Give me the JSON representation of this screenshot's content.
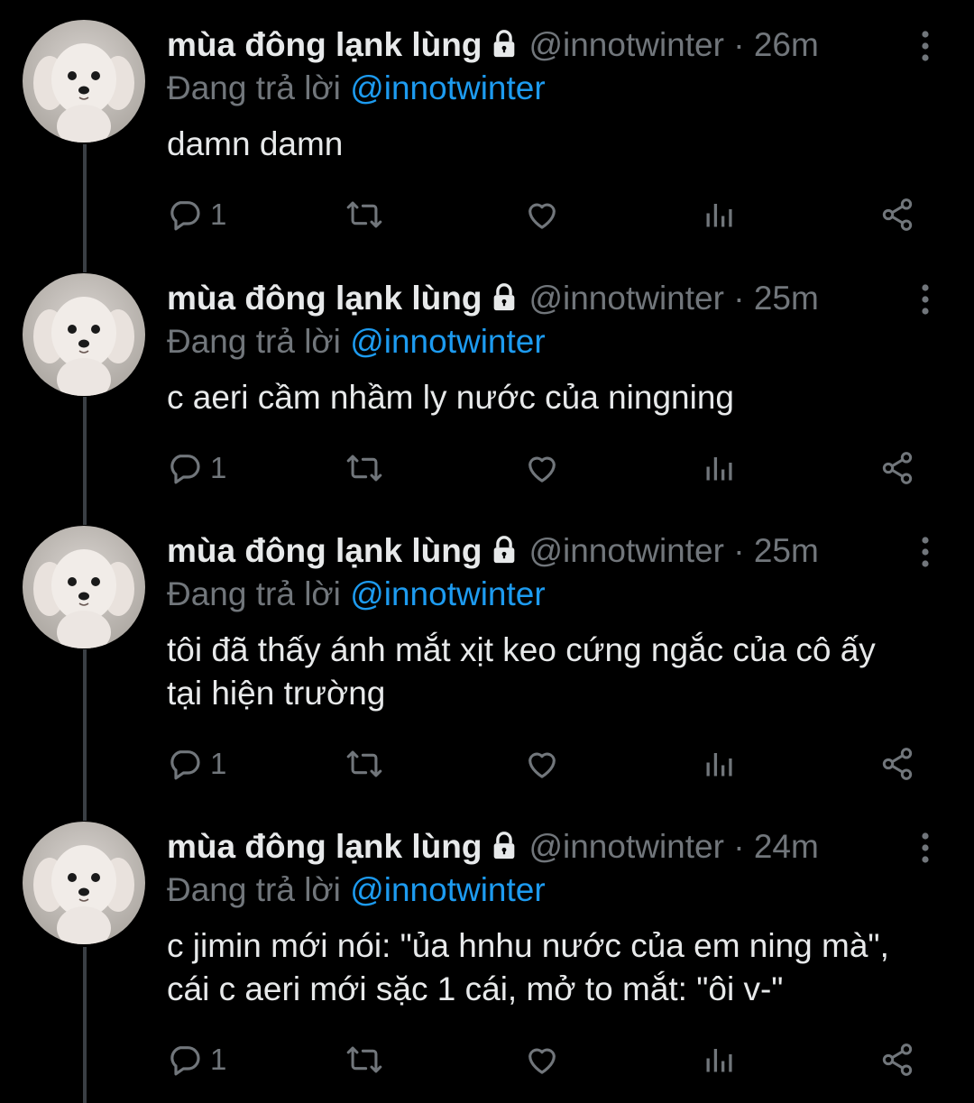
{
  "tweets": [
    {
      "name": "mùa đông lạnk lùng",
      "handle": "@innotwinter",
      "separator": "·",
      "time": "26m",
      "replying_prefix": "Đang trả lời",
      "replying_to": "@innotwinter",
      "text": "damn damn",
      "reply_count": "1"
    },
    {
      "name": "mùa đông lạnk lùng",
      "handle": "@innotwinter",
      "separator": "·",
      "time": "25m",
      "replying_prefix": "Đang trả lời",
      "replying_to": "@innotwinter",
      "text": "c aeri cầm nhầm ly nước của ningning",
      "reply_count": "1"
    },
    {
      "name": "mùa đông lạnk lùng",
      "handle": "@innotwinter",
      "separator": "·",
      "time": "25m",
      "replying_prefix": "Đang trả lời",
      "replying_to": "@innotwinter",
      "text": "tôi đã thấy ánh mắt xịt keo cứng ngắc của cô ấy\ntại hiện trường",
      "reply_count": "1"
    },
    {
      "name": "mùa đông lạnk lùng",
      "handle": "@innotwinter",
      "separator": "·",
      "time": "24m",
      "replying_prefix": "Đang trả lời",
      "replying_to": "@innotwinter",
      "text": "c jimin mới nói: \"ủa hnhu nước của em ning mà\",\ncái c aeri mới sặc 1 cái, mở to mắt: \"ôi v-\"",
      "reply_count": "1"
    }
  ],
  "icons": {
    "reply": "reply-icon",
    "retweet": "retweet-icon",
    "like": "heart-icon",
    "views": "bar-chart-icon",
    "share": "share-icon",
    "more": "more-vertical-icon",
    "lock": "lock-icon"
  },
  "colors": {
    "background": "#000000",
    "text": "#e7e9ea",
    "muted": "#71767b",
    "link": "#1d9bf0",
    "thread_line": "#3a3f44"
  }
}
